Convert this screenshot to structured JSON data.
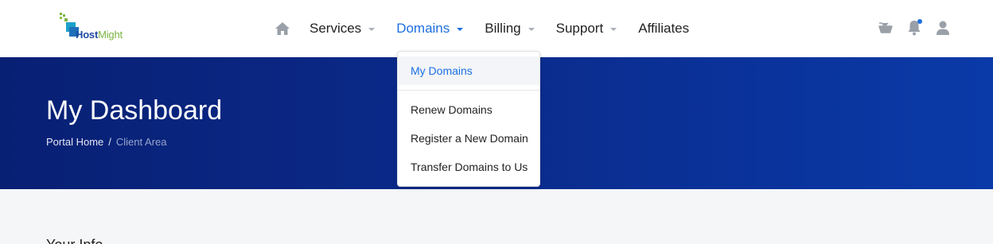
{
  "brand": {
    "logo_text_main": "Host",
    "logo_text_alt": "Might",
    "colors": {
      "primary": "#1e4aa3",
      "accent": "#7cb342"
    }
  },
  "nav": {
    "home_icon": "home-icon",
    "items": [
      {
        "label": "Services",
        "has_caret": true
      },
      {
        "label": "Domains",
        "has_caret": true,
        "active": true
      },
      {
        "label": "Billing",
        "has_caret": true
      },
      {
        "label": "Support",
        "has_caret": true
      },
      {
        "label": "Affiliates",
        "has_caret": false
      }
    ],
    "right_icons": [
      "cart-icon",
      "bell-icon",
      "user-icon"
    ],
    "active_color": "#1d6fe0"
  },
  "hero": {
    "title": "My Dashboard",
    "breadcrumb": {
      "home": "Portal Home",
      "separator": "/",
      "current": "Client Area"
    },
    "gradient": [
      "#082074",
      "#0a3aa8"
    ]
  },
  "domains_menu": {
    "items": [
      {
        "label": "My Domains",
        "selected": true
      },
      {
        "label": "Renew Domains"
      },
      {
        "label": "Register a New Domain"
      },
      {
        "label": "Transfer Domains to Us"
      }
    ]
  },
  "content": {
    "section_heading": "Your Info"
  }
}
